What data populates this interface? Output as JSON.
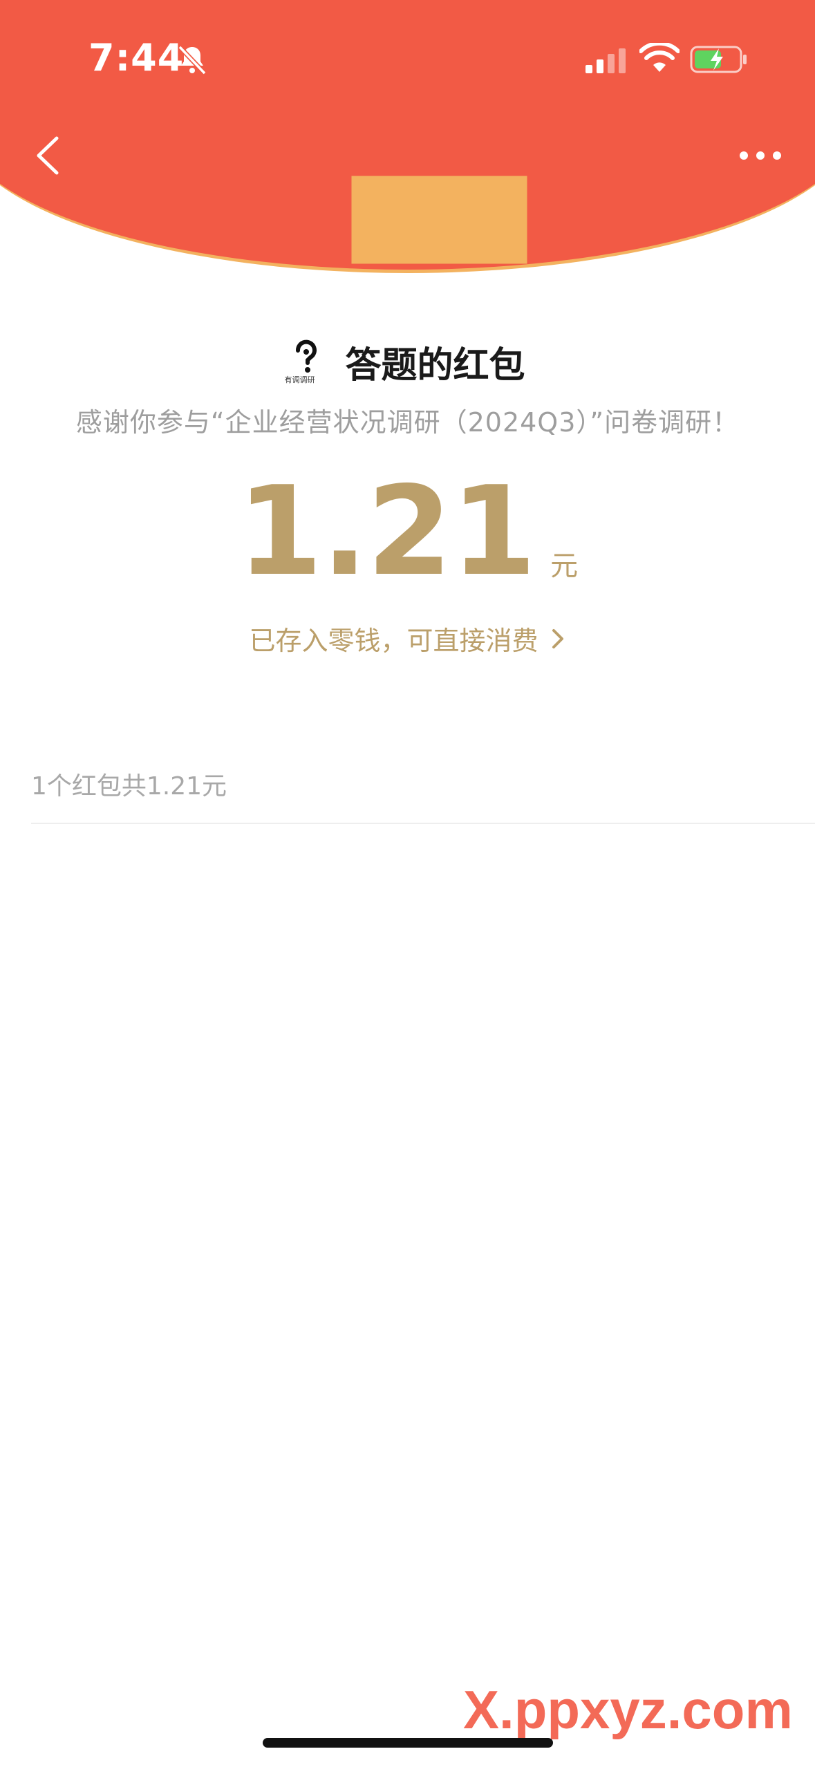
{
  "status_bar": {
    "time": "7:44"
  },
  "header": {
    "bg_color": "#f25a45",
    "edge_color": "#f3b25f"
  },
  "card": {
    "title": "答题的红包",
    "logo_caption": "有调调研",
    "thanks": "感谢你参与“企业经营状况调研（2024Q3）”问卷调研！",
    "amount": "1.21",
    "unit": "元",
    "wallet_link": "已存入零钱，可直接消费",
    "accent_color": "#bb9f6a"
  },
  "summary": {
    "text": "1个红包共1.21元"
  },
  "watermark": {
    "text": "X.ppxyz.com"
  }
}
